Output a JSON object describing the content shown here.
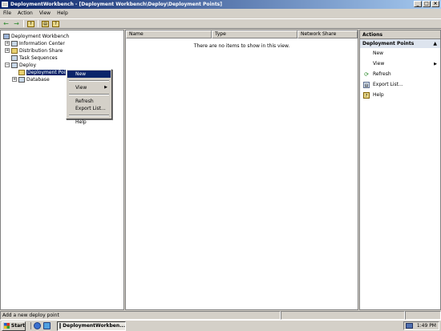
{
  "window": {
    "title": "DeploymentWorkbench - [Deployment Workbench\\Deploy\\Deployment Points]"
  },
  "menubar": {
    "file": "File",
    "action": "Action",
    "view": "View",
    "help": "Help"
  },
  "tree": {
    "root": "Deployment Workbench",
    "items": [
      {
        "label": "Information Center",
        "expander": "+"
      },
      {
        "label": "Distribution Share",
        "expander": "+"
      },
      {
        "label": "Task Sequences",
        "expander": ""
      },
      {
        "label": "Deploy",
        "expander": "−"
      },
      {
        "label": "Deployment Points",
        "expander": ""
      },
      {
        "label": "Database",
        "expander": "+"
      }
    ]
  },
  "list": {
    "columns": [
      "Name",
      "Type",
      "Network Share"
    ],
    "empty_message": "There are no items to show in this view."
  },
  "actions": {
    "header": "Actions",
    "section": "Deployment Points",
    "collapse_glyph": "▲",
    "items": [
      {
        "label": "New",
        "icon": ""
      },
      {
        "label": "View",
        "icon": "",
        "submenu": "▶"
      },
      {
        "label": "Refresh",
        "icon": "refresh-icon"
      },
      {
        "label": "Export List...",
        "icon": "export-list-icon"
      },
      {
        "label": "Help",
        "icon": "help-icon"
      }
    ]
  },
  "context_menu": {
    "items": [
      {
        "label": "New"
      },
      {
        "label": "View",
        "submenu": "▶"
      },
      {
        "label": "Refresh"
      },
      {
        "label": "Export List..."
      },
      {
        "label": "Help"
      }
    ]
  },
  "statusbar": {
    "text": "Add a new deploy point"
  },
  "taskbar": {
    "start": "Start",
    "task": "DeploymentWorkben...",
    "clock": "1:49 PM"
  }
}
